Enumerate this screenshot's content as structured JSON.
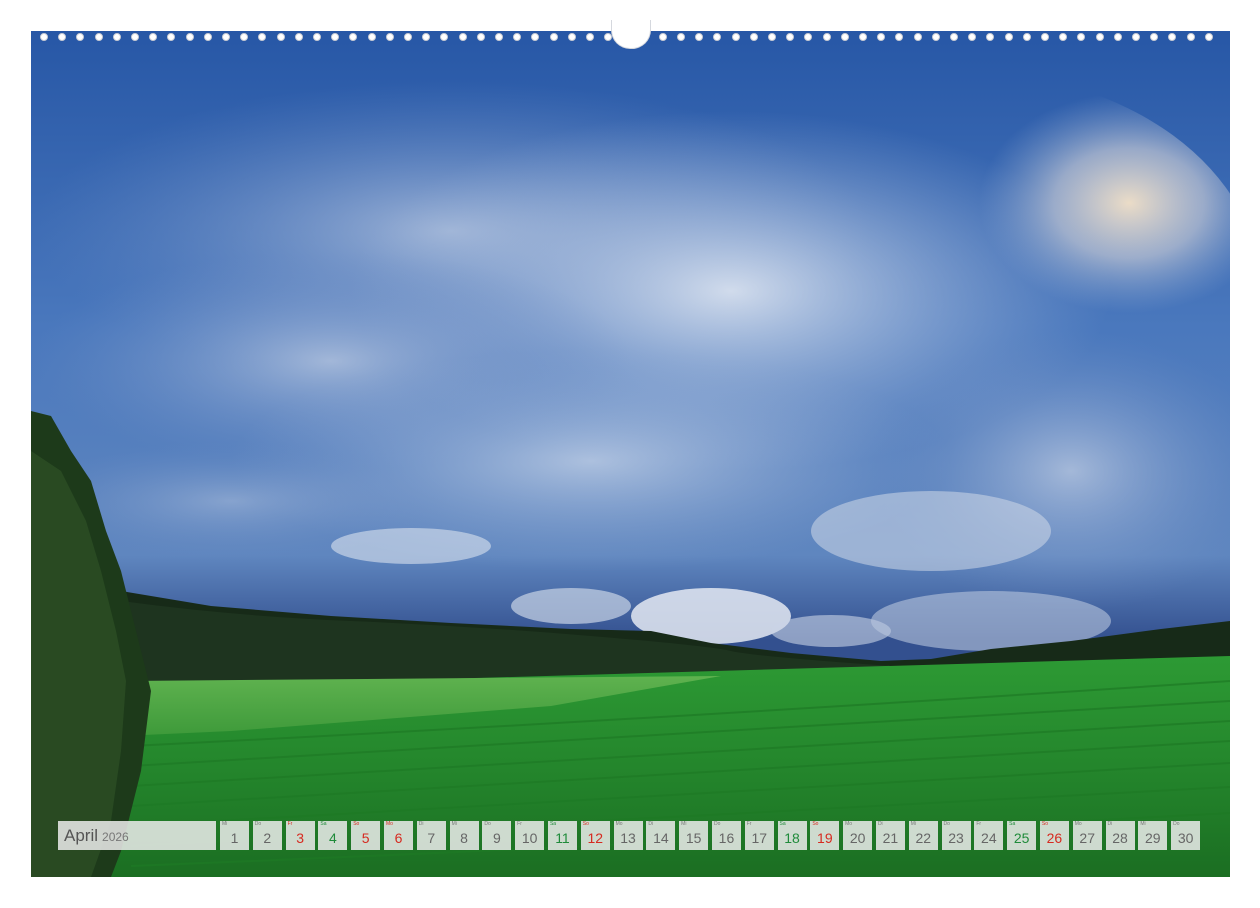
{
  "calendar": {
    "month": "April",
    "year": "2026",
    "days": [
      {
        "num": "1",
        "wd": "Mi",
        "kind": "normal"
      },
      {
        "num": "2",
        "wd": "Do",
        "kind": "normal"
      },
      {
        "num": "3",
        "wd": "Fr",
        "kind": "hol"
      },
      {
        "num": "4",
        "wd": "Sa",
        "kind": "sat"
      },
      {
        "num": "5",
        "wd": "So",
        "kind": "sun"
      },
      {
        "num": "6",
        "wd": "Mo",
        "kind": "hol"
      },
      {
        "num": "7",
        "wd": "Di",
        "kind": "normal"
      },
      {
        "num": "8",
        "wd": "Mi",
        "kind": "normal"
      },
      {
        "num": "9",
        "wd": "Do",
        "kind": "normal"
      },
      {
        "num": "10",
        "wd": "Fr",
        "kind": "normal"
      },
      {
        "num": "11",
        "wd": "Sa",
        "kind": "sat"
      },
      {
        "num": "12",
        "wd": "So",
        "kind": "sun"
      },
      {
        "num": "13",
        "wd": "Mo",
        "kind": "normal"
      },
      {
        "num": "14",
        "wd": "Di",
        "kind": "normal"
      },
      {
        "num": "15",
        "wd": "Mi",
        "kind": "normal"
      },
      {
        "num": "16",
        "wd": "Do",
        "kind": "normal"
      },
      {
        "num": "17",
        "wd": "Fr",
        "kind": "normal"
      },
      {
        "num": "18",
        "wd": "Sa",
        "kind": "sat"
      },
      {
        "num": "19",
        "wd": "So",
        "kind": "sun"
      },
      {
        "num": "20",
        "wd": "Mo",
        "kind": "normal"
      },
      {
        "num": "21",
        "wd": "Di",
        "kind": "normal"
      },
      {
        "num": "22",
        "wd": "Mi",
        "kind": "normal"
      },
      {
        "num": "23",
        "wd": "Do",
        "kind": "normal"
      },
      {
        "num": "24",
        "wd": "Fr",
        "kind": "normal"
      },
      {
        "num": "25",
        "wd": "Sa",
        "kind": "sat"
      },
      {
        "num": "26",
        "wd": "So",
        "kind": "sun"
      },
      {
        "num": "27",
        "wd": "Mo",
        "kind": "normal"
      },
      {
        "num": "28",
        "wd": "Di",
        "kind": "normal"
      },
      {
        "num": "29",
        "wd": "Mi",
        "kind": "normal"
      },
      {
        "num": "30",
        "wd": "Do",
        "kind": "normal"
      }
    ]
  },
  "colors": {
    "saturday": "#1f8b3a",
    "sunday": "#d62a20",
    "cell_bg": "#ebebeb",
    "sky_top": "#2a5aa8",
    "field_green": "#2fa33a"
  }
}
